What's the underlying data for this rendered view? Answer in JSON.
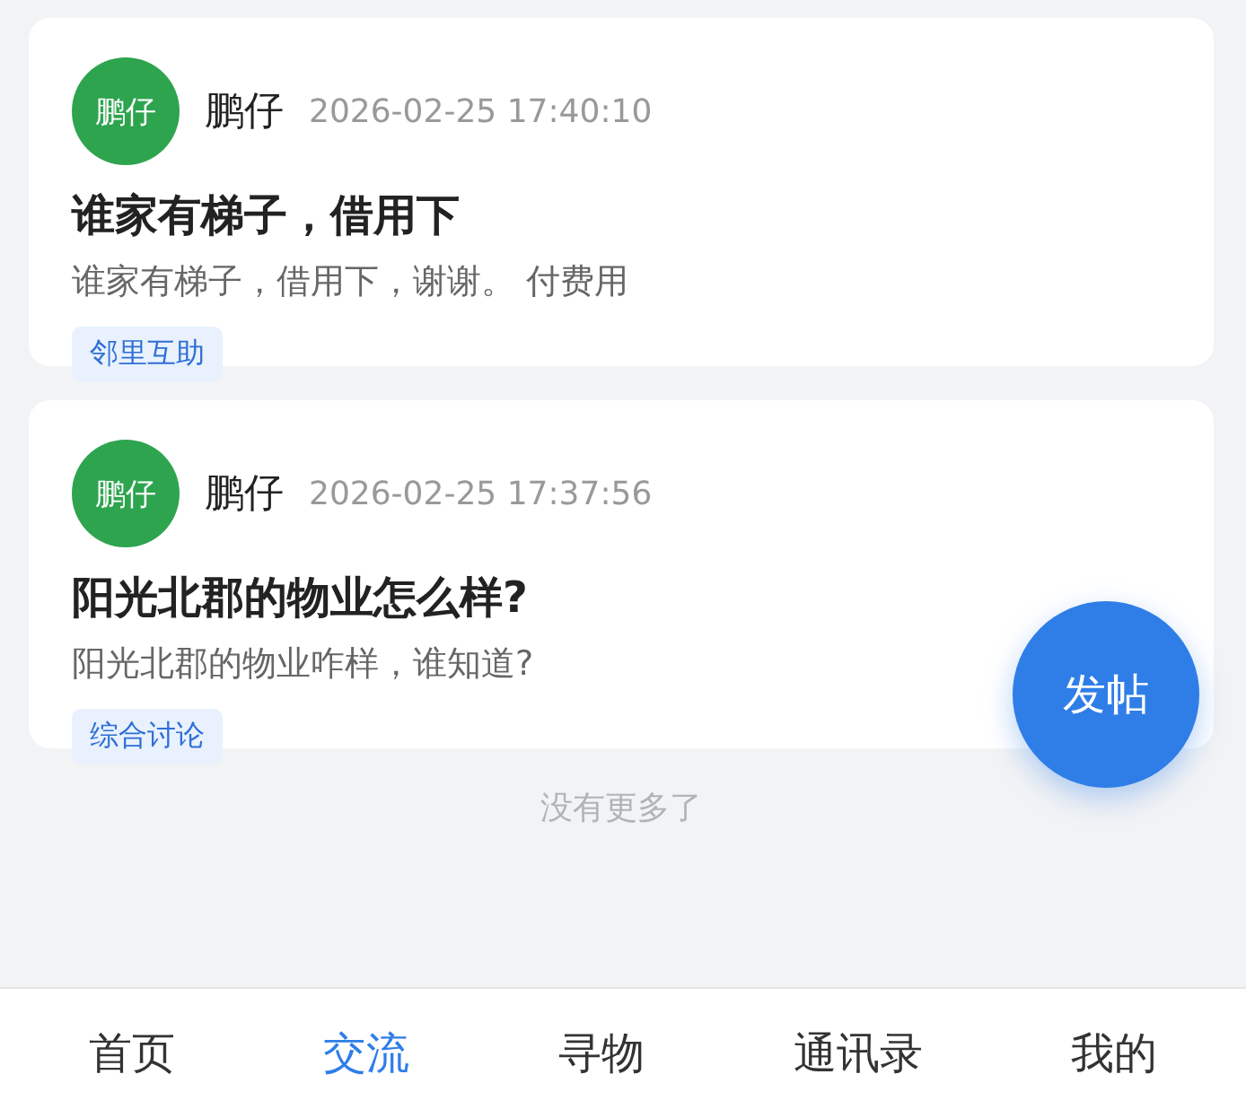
{
  "posts": [
    {
      "avatar": "鹏仔",
      "author": "鹏仔",
      "time": "2026-02-25 17:40:10",
      "title": "谁家有梯子，借用下",
      "body": "谁家有梯子，借用下，谢谢。 付费用",
      "tag": "邻里互助"
    },
    {
      "avatar": "鹏仔",
      "author": "鹏仔",
      "time": "2026-02-25 17:37:56",
      "title": "阳光北郡的物业怎么样?",
      "body": "阳光北郡的物业咋样，谁知道?",
      "tag": "综合讨论"
    }
  ],
  "end_note": "没有更多了",
  "fab": "发帖",
  "tabs": [
    {
      "label": "首页",
      "selected": false
    },
    {
      "label": "交流",
      "selected": true
    },
    {
      "label": "寻物",
      "selected": false
    },
    {
      "label": "通讯录",
      "selected": false
    },
    {
      "label": "我的",
      "selected": false
    }
  ]
}
